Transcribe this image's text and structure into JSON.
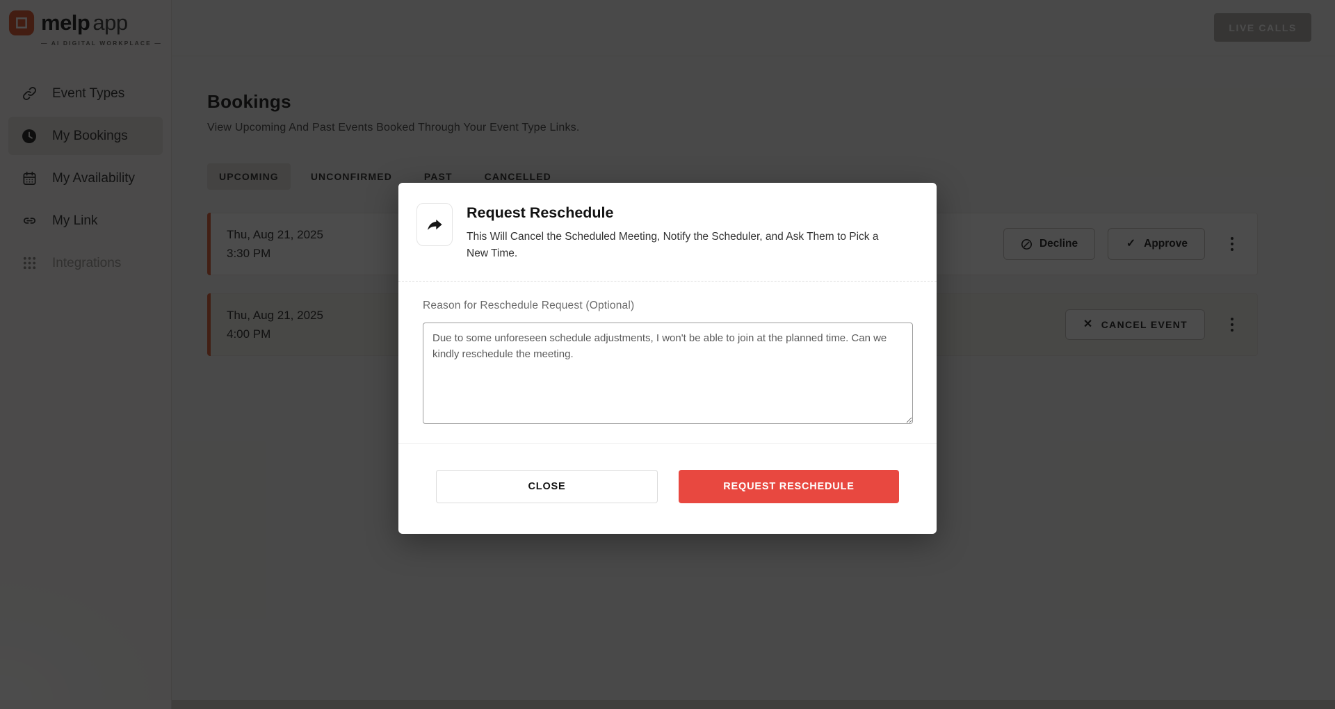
{
  "brand": {
    "name_bold": "melp",
    "name_light": "app",
    "tagline": "— AI DIGITAL WORKPLACE —"
  },
  "header": {
    "live_calls_label": "LIVE CALLS"
  },
  "sidebar": {
    "items": [
      {
        "label": "Event Types",
        "icon": "link-icon",
        "active": false,
        "disabled": false
      },
      {
        "label": "My Bookings",
        "icon": "clock-icon",
        "active": true,
        "disabled": false
      },
      {
        "label": "My Availability",
        "icon": "calendar-icon",
        "active": false,
        "disabled": false
      },
      {
        "label": "My Link",
        "icon": "chain-icon",
        "active": false,
        "disabled": false
      },
      {
        "label": "Integrations",
        "icon": "grid-dots-icon",
        "active": false,
        "disabled": true
      }
    ]
  },
  "page": {
    "title": "Bookings",
    "subtitle": "View Upcoming And Past Events Booked Through Your Event Type Links."
  },
  "tabs": [
    {
      "label": "UPCOMING",
      "active": true
    },
    {
      "label": "UNCONFIRMED",
      "active": false
    },
    {
      "label": "PAST",
      "active": false
    },
    {
      "label": "CANCELLED",
      "active": false
    }
  ],
  "bookings": [
    {
      "date": "Thu, Aug 21, 2025",
      "time": "3:30 PM",
      "decline_label": "Decline",
      "approve_label": "Approve"
    },
    {
      "date": "Thu, Aug 21, 2025",
      "time": "4:00 PM",
      "cancel_label": "CANCEL EVENT"
    }
  ],
  "modal": {
    "title": "Request Reschedule",
    "description": "This Will Cancel the Scheduled Meeting, Notify the Scheduler, and Ask Them to Pick a New Time.",
    "reason_label": "Reason for Reschedule Request (Optional)",
    "reason_value": "Due to some unforeseen schedule adjustments, I won't be able to join at the planned time. Can we kindly reschedule the meeting.",
    "close_label": "CLOSE",
    "submit_label": "REQUEST RESCHEDULE",
    "icon": "forward-arrow-icon"
  },
  "colors": {
    "accent_red": "#e84840",
    "accent_bar_orange": "#dd6a45",
    "brand_orange": "#e2613c"
  }
}
